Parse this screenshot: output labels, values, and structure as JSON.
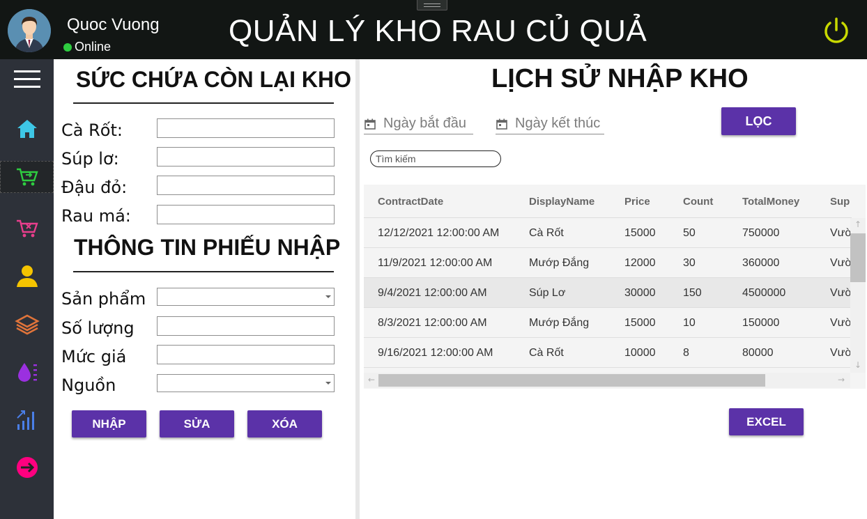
{
  "header": {
    "user_name": "Quoc Vuong",
    "status": "Online",
    "title": "QUẢN LÝ KHO RAU CỦ QUẢ"
  },
  "sidebar": {
    "items": [
      {
        "icon": "menu-icon"
      },
      {
        "icon": "home-icon",
        "color": "#3ec7e6"
      },
      {
        "icon": "cart-import-icon",
        "color": "#2ecc40"
      },
      {
        "icon": "cart-remove-icon",
        "color": "#e83e8c"
      },
      {
        "icon": "user-icon",
        "color": "#f5c400"
      },
      {
        "icon": "layers-icon",
        "color": "#e0743a"
      },
      {
        "icon": "water-icon",
        "color": "#9b30e0"
      },
      {
        "icon": "signal-icon",
        "color": "#4a7fe8"
      },
      {
        "icon": "logout-icon",
        "color": "#ff007f"
      }
    ]
  },
  "capacity": {
    "title": "SỨC CHỨA CÒN LẠI KHO",
    "rows": [
      {
        "label": "Cà Rốt:",
        "value": ""
      },
      {
        "label": "Súp lơ:",
        "value": ""
      },
      {
        "label": "Đậu đỏ:",
        "value": ""
      },
      {
        "label": "Rau má:",
        "value": ""
      }
    ]
  },
  "receipt": {
    "title": "THÔNG TIN PHIẾU NHẬP",
    "product_label": "Sản phẩm",
    "quantity_label": "Số lượng",
    "price_label": "Mức giá",
    "source_label": "Nguồn",
    "product_value": "",
    "quantity_value": "",
    "price_value": "",
    "source_value": ""
  },
  "actions": {
    "import": "NHẬP",
    "edit": "SỬA",
    "delete": "XÓA"
  },
  "history": {
    "title": "LỊCH SỬ NHẬP KHO",
    "start_date_placeholder": "Ngày bắt đầu",
    "end_date_placeholder": "Ngày kết thúc",
    "filter_button": "LỌC",
    "search_placeholder": "Tìm kiếm",
    "excel_button": "EXCEL",
    "columns": [
      "ContractDate",
      "DisplayName",
      "Price",
      "Count",
      "TotalMoney",
      "Sup"
    ],
    "rows": [
      [
        "12/12/2021 12:00:00 AM",
        "Cà Rốt",
        "15000",
        "50",
        "750000",
        "Vườ"
      ],
      [
        "11/9/2021 12:00:00 AM",
        "Mướp Đắng",
        "12000",
        "30",
        "360000",
        "Vườ"
      ],
      [
        "9/4/2021 12:00:00 AM",
        "Súp Lơ",
        "30000",
        "150",
        "4500000",
        "Vườ"
      ],
      [
        "8/3/2021 12:00:00 AM",
        "Mướp Đắng",
        "15000",
        "10",
        "150000",
        "Vườ"
      ],
      [
        "9/16/2021 12:00:00 AM",
        "Cà Rốt",
        "10000",
        "8",
        "80000",
        "Vườ"
      ]
    ],
    "selected_row": 2
  },
  "colors": {
    "header_bg": "#121614",
    "sidebar_bg": "#2d3139",
    "button_bg": "#5b32a8",
    "power_icon": "#c8d900",
    "online": "#2ecc40"
  }
}
